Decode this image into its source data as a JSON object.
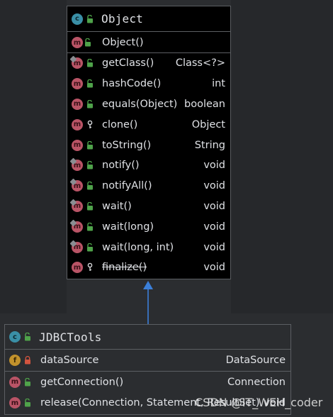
{
  "object_class": {
    "icon": "class-icon",
    "name": "Object",
    "constructors": [
      {
        "name": "Object()",
        "type": "",
        "visibility": "public"
      }
    ],
    "methods": [
      {
        "name": "getClass()",
        "type": "Class<?>",
        "visibility": "public",
        "overlay": true,
        "strike": false
      },
      {
        "name": "hashCode()",
        "type": "int",
        "visibility": "public",
        "overlay": false,
        "strike": false
      },
      {
        "name": "equals(Object)",
        "type": "boolean",
        "visibility": "public",
        "overlay": false,
        "strike": false
      },
      {
        "name": "clone()",
        "type": "Object",
        "visibility": "protected",
        "overlay": false,
        "strike": false
      },
      {
        "name": "toString()",
        "type": "String",
        "visibility": "public",
        "overlay": false,
        "strike": false
      },
      {
        "name": "notify()",
        "type": "void",
        "visibility": "public",
        "overlay": true,
        "strike": false
      },
      {
        "name": "notifyAll()",
        "type": "void",
        "visibility": "public",
        "overlay": true,
        "strike": false
      },
      {
        "name": "wait()",
        "type": "void",
        "visibility": "public",
        "overlay": true,
        "strike": false
      },
      {
        "name": "wait(long)",
        "type": "void",
        "visibility": "public",
        "overlay": true,
        "strike": false
      },
      {
        "name": "wait(long, int)",
        "type": "void",
        "visibility": "public",
        "overlay": true,
        "strike": false
      },
      {
        "name": "finalize()",
        "type": "void",
        "visibility": "protected",
        "overlay": false,
        "strike": true
      }
    ]
  },
  "jdbc_class": {
    "icon": "class-icon",
    "name": "JDBCTools",
    "fields": [
      {
        "name": "dataSource",
        "type": "DataSource",
        "visibility": "private"
      }
    ],
    "methods": [
      {
        "name": "getConnection()",
        "type": "Connection",
        "visibility": "public"
      },
      {
        "name": "release(Connection, Statement, ResultSet)",
        "type": "void",
        "visibility": "public"
      }
    ]
  },
  "watermark": "CSDN @IT_WEH_coder",
  "colors": {
    "background": "#2b2d30",
    "object_box_bg": "#000000",
    "border": "#5c5f63",
    "arrow": "#3b7fd9",
    "public_lock": "#4fa34a",
    "private_lock": "#d2543f",
    "method_icon": "#b95466",
    "class_icon": "#3a8fa6",
    "field_icon": "#c2922c"
  }
}
